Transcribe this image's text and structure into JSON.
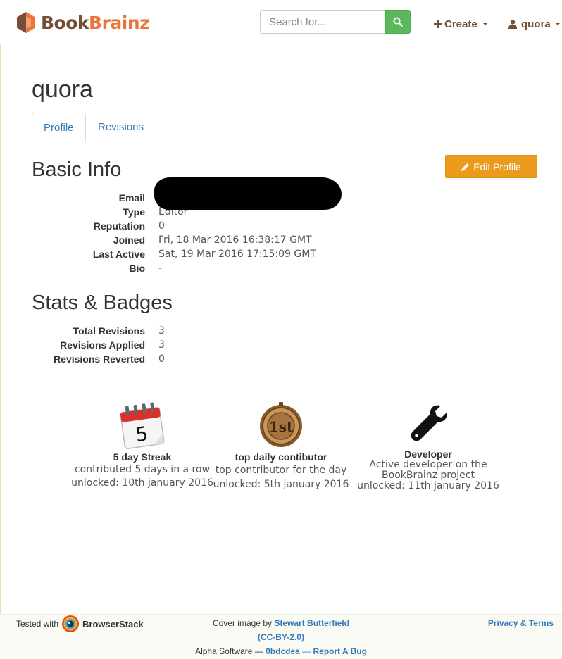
{
  "navbar": {
    "brand_part1": "Book",
    "brand_part2": "Brainz",
    "search_placeholder": "Search for...",
    "create_label": "Create",
    "user_label": "quora"
  },
  "page": {
    "title": "quora",
    "tabs": [
      "Profile",
      "Revisions"
    ],
    "active_tab": "Profile"
  },
  "basic_info": {
    "heading": "Basic Info",
    "edit_button": "Edit Profile",
    "rows": [
      {
        "label": "Email",
        "value": ""
      },
      {
        "label": "Type",
        "value": "Editor"
      },
      {
        "label": "Reputation",
        "value": "0"
      },
      {
        "label": "Joined",
        "value": "Fri, 18 Mar 2016 16:38:17 GMT"
      },
      {
        "label": "Last Active",
        "value": "Sat, 19 Mar 2016 17:15:09 GMT"
      },
      {
        "label": "Bio",
        "value": "-"
      }
    ]
  },
  "stats": {
    "heading": "Stats & Badges",
    "rows": [
      {
        "label": "Total Revisions",
        "value": "3"
      },
      {
        "label": "Revisions Applied",
        "value": "3"
      },
      {
        "label": "Revisions Reverted",
        "value": "0"
      }
    ]
  },
  "badges": [
    {
      "icon": "calendar-icon",
      "icon_text": "5",
      "title": "5 day Streak",
      "line1": "contributed 5 days in a row",
      "line2": "unlocked: 10th january 2016"
    },
    {
      "icon": "medal-icon",
      "icon_text": "1st",
      "title": "top daily contibutor",
      "line1": "top contributor for the day",
      "line2": "unlocked: 5th january 2016"
    },
    {
      "icon": "wrench-icon",
      "title": "Developer",
      "line1": "Active developer on the",
      "line1b": "BookBrainz project",
      "line2": "unlocked: 11th january 2016"
    }
  ],
  "footer": {
    "tested_with": "Tested with",
    "browserstack": "BrowserStack",
    "cover_prefix": "Cover image by",
    "cover_author": "Stewart Butterfield",
    "license": "(CC-BY-2.0)",
    "alpha_prefix": "Alpha Software —",
    "commit": "0bdcdea",
    "dash": "—",
    "report_bug": "Report A Bug",
    "privacy": "Privacy & Terms"
  },
  "colors": {
    "brand_brown": "#754e37",
    "brand_orange": "#eb743b",
    "search_green": "#5cb85c",
    "edit_orange": "#eb9b1c",
    "link_blue": "#337ab7"
  }
}
